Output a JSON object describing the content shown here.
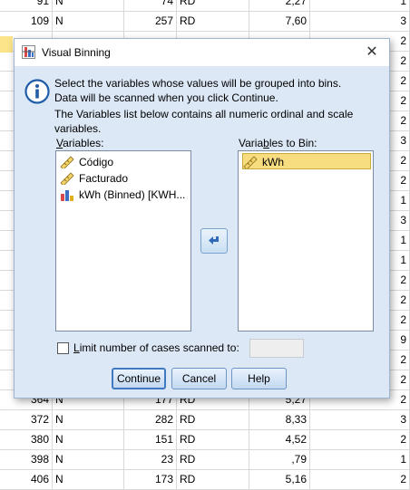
{
  "grid": {
    "rows": [
      [
        "91",
        "N",
        "74",
        "RD",
        "2,27",
        "1"
      ],
      [
        "109",
        "N",
        "257",
        "RD",
        "7,60",
        "3"
      ],
      [
        "",
        "",
        "",
        "",
        "",
        "2"
      ],
      [
        "",
        "",
        "",
        "",
        "",
        "2"
      ],
      [
        "",
        "",
        "",
        "",
        "",
        "2"
      ],
      [
        "",
        "",
        "",
        "",
        "",
        "2"
      ],
      [
        "",
        "",
        "",
        "",
        "",
        "2"
      ],
      [
        "",
        "",
        "",
        "",
        "",
        "3"
      ],
      [
        "",
        "",
        "",
        "",
        "",
        "2"
      ],
      [
        "",
        "",
        "",
        "",
        "",
        "2"
      ],
      [
        "",
        "",
        "",
        "",
        "",
        "1"
      ],
      [
        "",
        "",
        "",
        "",
        "",
        "3"
      ],
      [
        "",
        "",
        "",
        "",
        "",
        "1"
      ],
      [
        "",
        "",
        "",
        "",
        "",
        "1"
      ],
      [
        "",
        "",
        "",
        "",
        "",
        "2"
      ],
      [
        "",
        "",
        "",
        "",
        "",
        "2"
      ],
      [
        "",
        "",
        "",
        "",
        "",
        "2"
      ],
      [
        "",
        "",
        "",
        "",
        "",
        "9"
      ],
      [
        "",
        "",
        "",
        "",
        "",
        "2"
      ],
      [
        "",
        "",
        "",
        "",
        "",
        "2"
      ],
      [
        "364",
        "N",
        "177",
        "RD",
        "5,27",
        "2"
      ],
      [
        "372",
        "N",
        "282",
        "RD",
        "8,33",
        "3"
      ],
      [
        "380",
        "N",
        "151",
        "RD",
        "4,52",
        "2"
      ],
      [
        "398",
        "N",
        "23",
        "RD",
        ",79",
        "1"
      ],
      [
        "406",
        "N",
        "173",
        "RD",
        "5,16",
        "2"
      ]
    ]
  },
  "dialog": {
    "title": "Visual Binning",
    "message": [
      "Select the variables whose values will be grouped into bins.",
      "Data will be scanned when you click Continue.",
      "The Variables list below contains all numeric ordinal and scale",
      "variables."
    ],
    "variables_label_pre": "",
    "variables_label_u": "V",
    "variables_label_post": "ariables:",
    "variables": [
      {
        "label": "Código",
        "icon": "ruler-icon"
      },
      {
        "label": "Facturado",
        "icon": "ruler-icon"
      },
      {
        "label": "kWh (Binned) [KWH...",
        "icon": "bar-chart-icon"
      }
    ],
    "to_bin_label_pre": "Varia",
    "to_bin_label_u": "b",
    "to_bin_label_post": "les to Bin:",
    "to_bin": [
      {
        "label": "kWh",
        "icon": "ruler-icon",
        "selected": true
      }
    ],
    "limit_label_pre": "",
    "limit_label_u": "L",
    "limit_label_post": "imit number of cases scanned to:",
    "limit_checked": false,
    "limit_value": "",
    "buttons": {
      "continue": "Continue",
      "cancel": "Cancel",
      "help": "Help"
    }
  },
  "colors": {
    "dialog_bg": "#dce8f6",
    "selection": "#f7dd80",
    "button_border": "#6d94c4"
  }
}
